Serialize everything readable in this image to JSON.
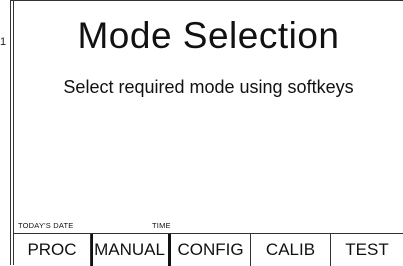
{
  "page_number": "1",
  "screen": {
    "title": "Mode Selection",
    "subtitle": "Select required mode using softkeys"
  },
  "footer": {
    "date_label": "TODAY'S DATE",
    "time_label": "TIME"
  },
  "softkeys": [
    {
      "label": "PROC"
    },
    {
      "label": "MANUAL"
    },
    {
      "label": "CONFIG"
    },
    {
      "label": "CALIB"
    },
    {
      "label": "TEST"
    }
  ]
}
